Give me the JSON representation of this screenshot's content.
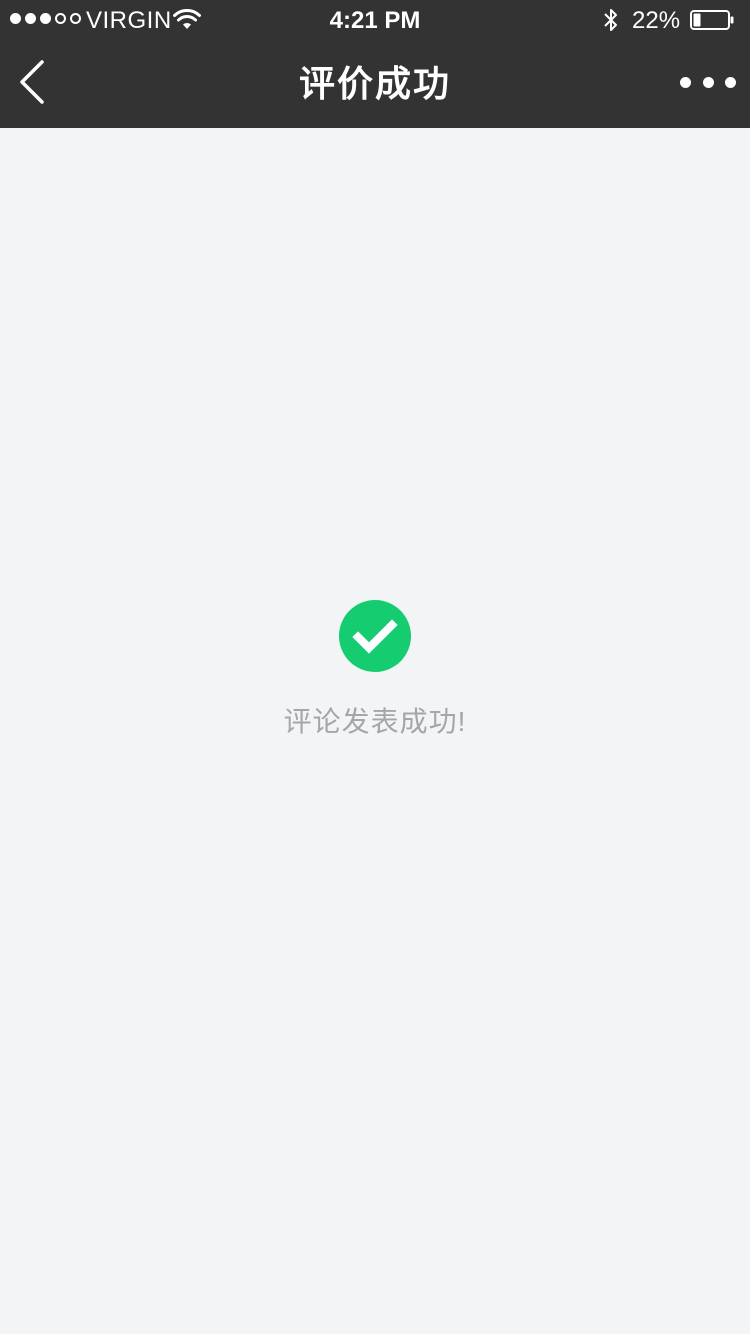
{
  "status_bar": {
    "signal_bars": [
      true,
      true,
      true,
      false,
      false
    ],
    "carrier": "VIRGIN",
    "time": "4:21 PM",
    "battery_percent_text": "22%",
    "battery_level": 0.22
  },
  "nav": {
    "title": "评价成功",
    "back_icon": "chevron-left-icon",
    "more_icon": "more-dots-icon"
  },
  "result": {
    "icon": "check-circle-icon",
    "icon_color": "#15cd70",
    "message": "评论发表成功!"
  },
  "colors": {
    "header_bg": "#333333",
    "page_bg": "#f3f4f6",
    "message_text": "#a6a6a6"
  }
}
